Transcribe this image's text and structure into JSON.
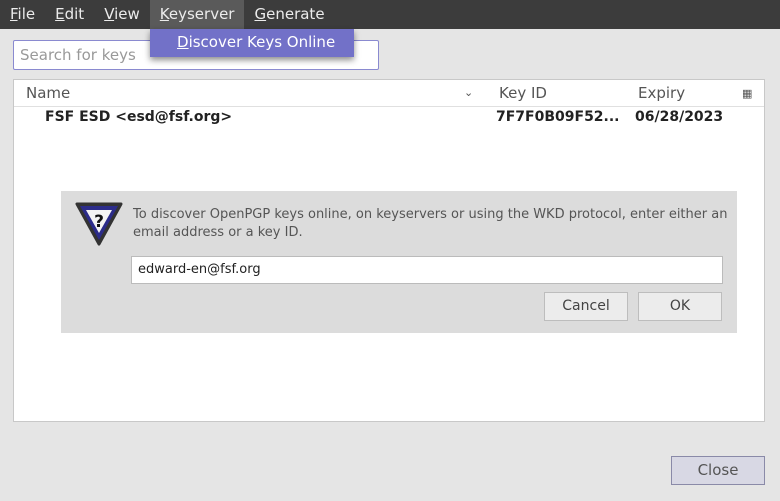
{
  "menubar": {
    "items": [
      {
        "key": "F",
        "rest": "ile"
      },
      {
        "key": "E",
        "rest": "dit"
      },
      {
        "key": "V",
        "rest": "iew"
      },
      {
        "key": "K",
        "rest": "eyserver"
      },
      {
        "key": "G",
        "rest": "enerate"
      }
    ]
  },
  "dropdown": {
    "key": "D",
    "rest": "iscover Keys Online"
  },
  "search": {
    "placeholder": "Search for keys"
  },
  "table": {
    "columns": [
      "Name",
      "Key ID",
      "Expiry"
    ],
    "rows": [
      {
        "name": "FSF ESD <esd@fsf.org>",
        "key_id": "7F7F0B09F52...",
        "expiry": "06/28/2023"
      }
    ]
  },
  "dialog": {
    "icon": "question-icon",
    "message": "To discover OpenPGP keys online, on keyservers or using the WKD protocol, enter either an email address or a key ID.",
    "value": "edward-en@fsf.org",
    "cancel": "Cancel",
    "ok": "OK"
  },
  "close": "Close",
  "colors": {
    "accent": "#7271c8",
    "menubar": "#3c3c3c"
  }
}
